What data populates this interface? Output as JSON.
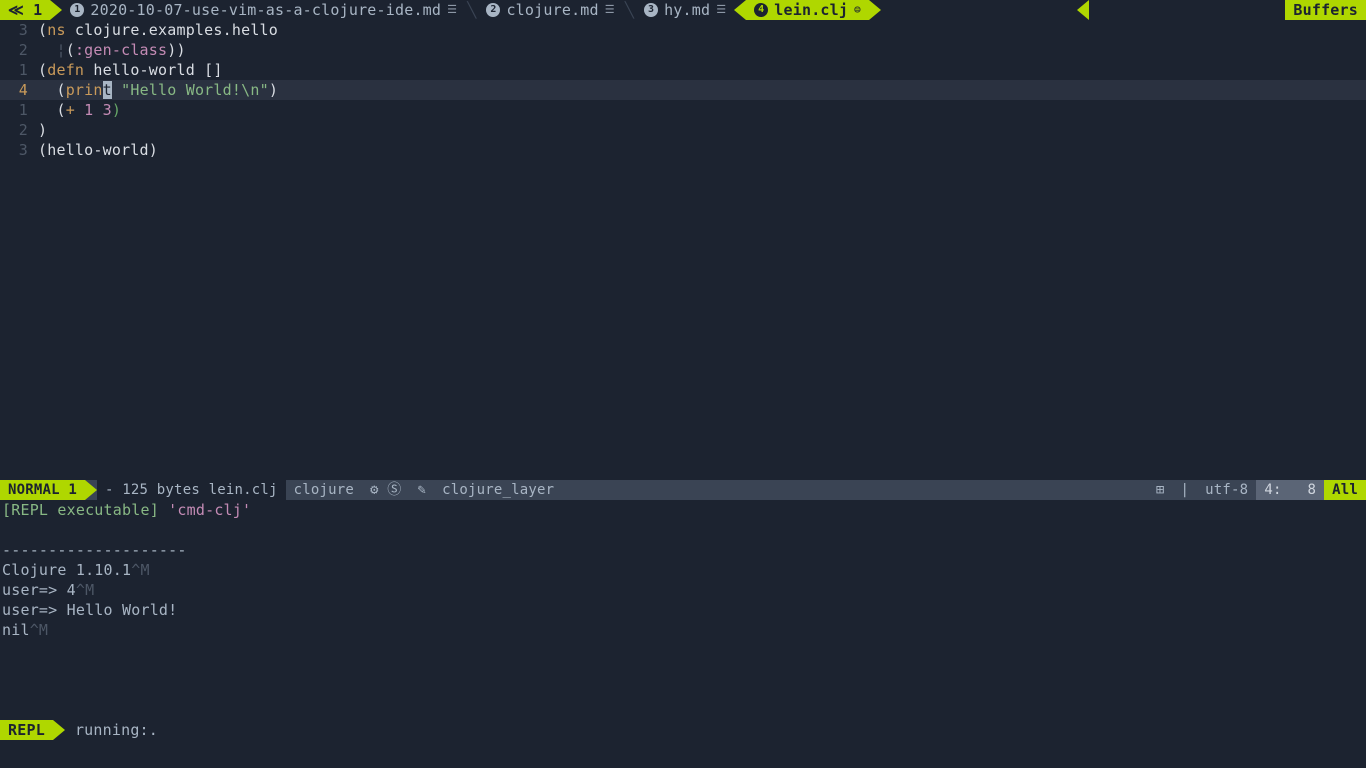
{
  "tabbar": {
    "left_marker": "≪ 1",
    "tabs": [
      {
        "num": "1",
        "name": "2020-10-07-use-vim-as-a-clojure-ide.md",
        "flag": "☰"
      },
      {
        "num": "2",
        "name": "clojure.md",
        "flag": "☰"
      },
      {
        "num": "3",
        "name": "hy.md",
        "flag": "☰"
      },
      {
        "num": "4",
        "name": "lein.clj",
        "flag": "⊜"
      }
    ],
    "right": "Buffers"
  },
  "code": {
    "lines": [
      {
        "rel": "3",
        "cur": false,
        "tokens": [
          {
            "t": "(",
            "c": "tok-paren"
          },
          {
            "t": "ns",
            "c": "tok-key"
          },
          {
            "t": " clojure.examples.hello",
            "c": "tok-ident"
          }
        ]
      },
      {
        "rel": "2",
        "cur": false,
        "tokens": [
          {
            "t": "  ",
            "c": ""
          },
          {
            "t": "¦",
            "c": "tok-muted"
          },
          {
            "t": "(",
            "c": "tok-paren"
          },
          {
            "t": ":gen-class",
            "c": "tok-kw"
          },
          {
            "t": "))",
            "c": "tok-paren"
          }
        ]
      },
      {
        "rel": "1",
        "cur": false,
        "tokens": [
          {
            "t": "(",
            "c": "tok-paren"
          },
          {
            "t": "defn",
            "c": "tok-key"
          },
          {
            "t": " hello-world []",
            "c": "tok-ident"
          }
        ]
      },
      {
        "rel": "4",
        "cur": true,
        "tokens": [
          {
            "t": "  (",
            "c": "tok-paren"
          },
          {
            "t": "prin",
            "c": "tok-key"
          },
          {
            "t": "t",
            "c": "cursor-block"
          },
          {
            "t": " ",
            "c": ""
          },
          {
            "t": "\"Hello World!\\n\"",
            "c": "tok-string"
          },
          {
            "t": ")",
            "c": "tok-paren"
          }
        ]
      },
      {
        "rel": "1",
        "cur": false,
        "tokens": [
          {
            "t": "  (",
            "c": "tok-paren"
          },
          {
            "t": "+",
            "c": "tok-key"
          },
          {
            "t": " ",
            "c": ""
          },
          {
            "t": "1",
            "c": "tok-num"
          },
          {
            "t": " ",
            "c": ""
          },
          {
            "t": "3",
            "c": "tok-num"
          },
          {
            "t": ")",
            "c": "tok-rparen-g"
          }
        ]
      },
      {
        "rel": "2",
        "cur": false,
        "tokens": [
          {
            "t": ")",
            "c": "tok-paren"
          }
        ]
      },
      {
        "rel": "3",
        "cur": false,
        "tokens": [
          {
            "t": "(",
            "c": "tok-paren"
          },
          {
            "t": "hello-world",
            "c": "tok-ident"
          },
          {
            "t": ")",
            "c": "tok-paren"
          }
        ]
      }
    ]
  },
  "statusline": {
    "mode": "NORMAL 1",
    "fileinfo": "- 125 bytes lein.clj",
    "filetype": "clojure",
    "git": "⚙ Ⓢ",
    "layer_icon": "✎",
    "layer": "clojure_layer",
    "os_icon": "⊞",
    "sep1": "|",
    "encoding": "utf-8",
    "pos": "4:   8",
    "percent": "All"
  },
  "repl": {
    "lines": [
      {
        "segs": [
          {
            "t": "[REPL executable]",
            "c": "repl-bracket"
          },
          {
            "t": " ",
            "c": ""
          },
          {
            "t": "'cmd-clj'",
            "c": "repl-quote"
          }
        ]
      },
      {
        "segs": [
          {
            "t": "",
            "c": ""
          }
        ]
      },
      {
        "segs": [
          {
            "t": "--------------------",
            "c": ""
          }
        ]
      },
      {
        "segs": [
          {
            "t": "Clojure 1.10.1",
            "c": ""
          },
          {
            "t": "^M",
            "c": "repl-dim"
          }
        ]
      },
      {
        "segs": [
          {
            "t": "user=> 4",
            "c": ""
          },
          {
            "t": "^M",
            "c": "repl-dim"
          }
        ]
      },
      {
        "segs": [
          {
            "t": "user=> Hello World!",
            "c": ""
          }
        ]
      },
      {
        "segs": [
          {
            "t": "nil",
            "c": ""
          },
          {
            "t": "^M",
            "c": "repl-dim"
          }
        ]
      }
    ]
  },
  "replbar": {
    "label": "REPL",
    "status": "running:."
  }
}
